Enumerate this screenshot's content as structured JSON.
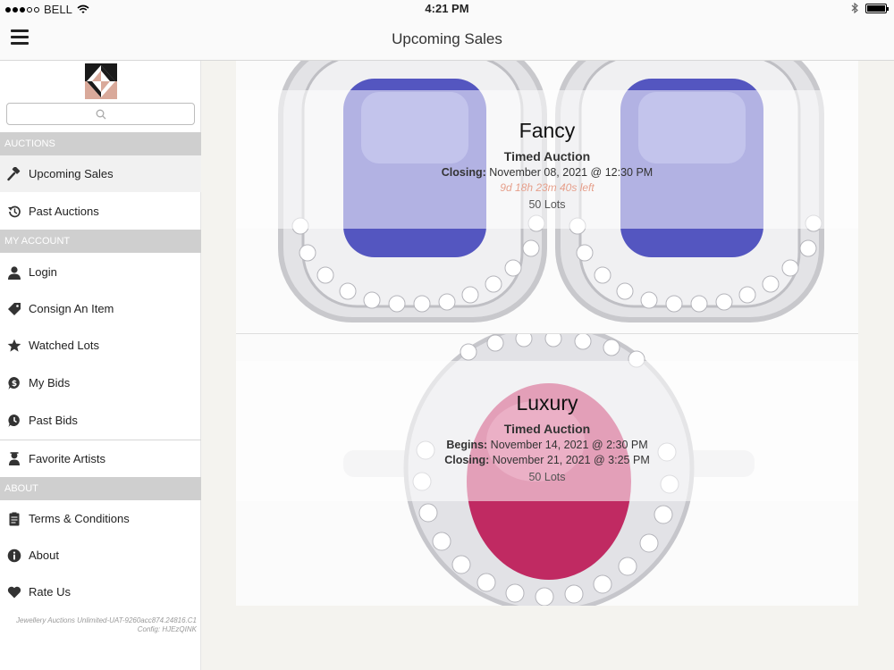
{
  "status": {
    "carrier": "BELL",
    "time": "4:21 PM",
    "signal_icon": "signal-dots-icon",
    "wifi_icon": "wifi-icon",
    "bluetooth_icon": "bluetooth-icon",
    "battery_icon": "battery-icon"
  },
  "nav": {
    "title": "Upcoming Sales",
    "menu_icon": "hamburger-menu-icon"
  },
  "sidebar": {
    "search_icon": "search-icon",
    "sections": {
      "auctions": "AUCTIONS",
      "account": "MY ACCOUNT",
      "about": "ABOUT"
    },
    "items": [
      {
        "label": "Upcoming Sales",
        "icon": "gavel-icon"
      },
      {
        "label": "Past Auctions",
        "icon": "history-icon"
      },
      {
        "label": "Login",
        "icon": "user-icon"
      },
      {
        "label": "Consign An Item",
        "icon": "tag-icon"
      },
      {
        "label": "Watched Lots",
        "icon": "star-icon"
      },
      {
        "label": "My Bids",
        "icon": "dollar-badge-icon"
      },
      {
        "label": "Past Bids",
        "icon": "clock-badge-icon"
      },
      {
        "label": "Favorite Artists",
        "icon": "artist-icon"
      },
      {
        "label": "Terms & Conditions",
        "icon": "document-icon"
      },
      {
        "label": "About",
        "icon": "info-icon"
      },
      {
        "label": "Rate Us",
        "icon": "heart-icon"
      }
    ],
    "version_line1": "Jewellery Auctions Unlimited-UAT-9260acc874.24816.C1",
    "version_line2": "Config: HJEzQINK"
  },
  "sales": [
    {
      "name": "Fancy",
      "type": "Timed Auction",
      "closing_label": "Closing:",
      "closing": "November 08, 2021 @ 12:30 PM",
      "countdown": "9d 18h 23m 40s left",
      "lots": "50 Lots"
    },
    {
      "name": "Luxury",
      "type": "Timed Auction",
      "begins_label": "Begins:",
      "begins": "November 14, 2021 @ 2:30 PM",
      "closing_label": "Closing:",
      "closing": "November 21, 2021 @ 3:25 PM",
      "lots": "50 Lots"
    }
  ],
  "colors": {
    "accent_section": "#cfcfcf",
    "countdown": "#e6a08c",
    "sapphire": "#5c5cc4",
    "ruby": "#c42860"
  }
}
